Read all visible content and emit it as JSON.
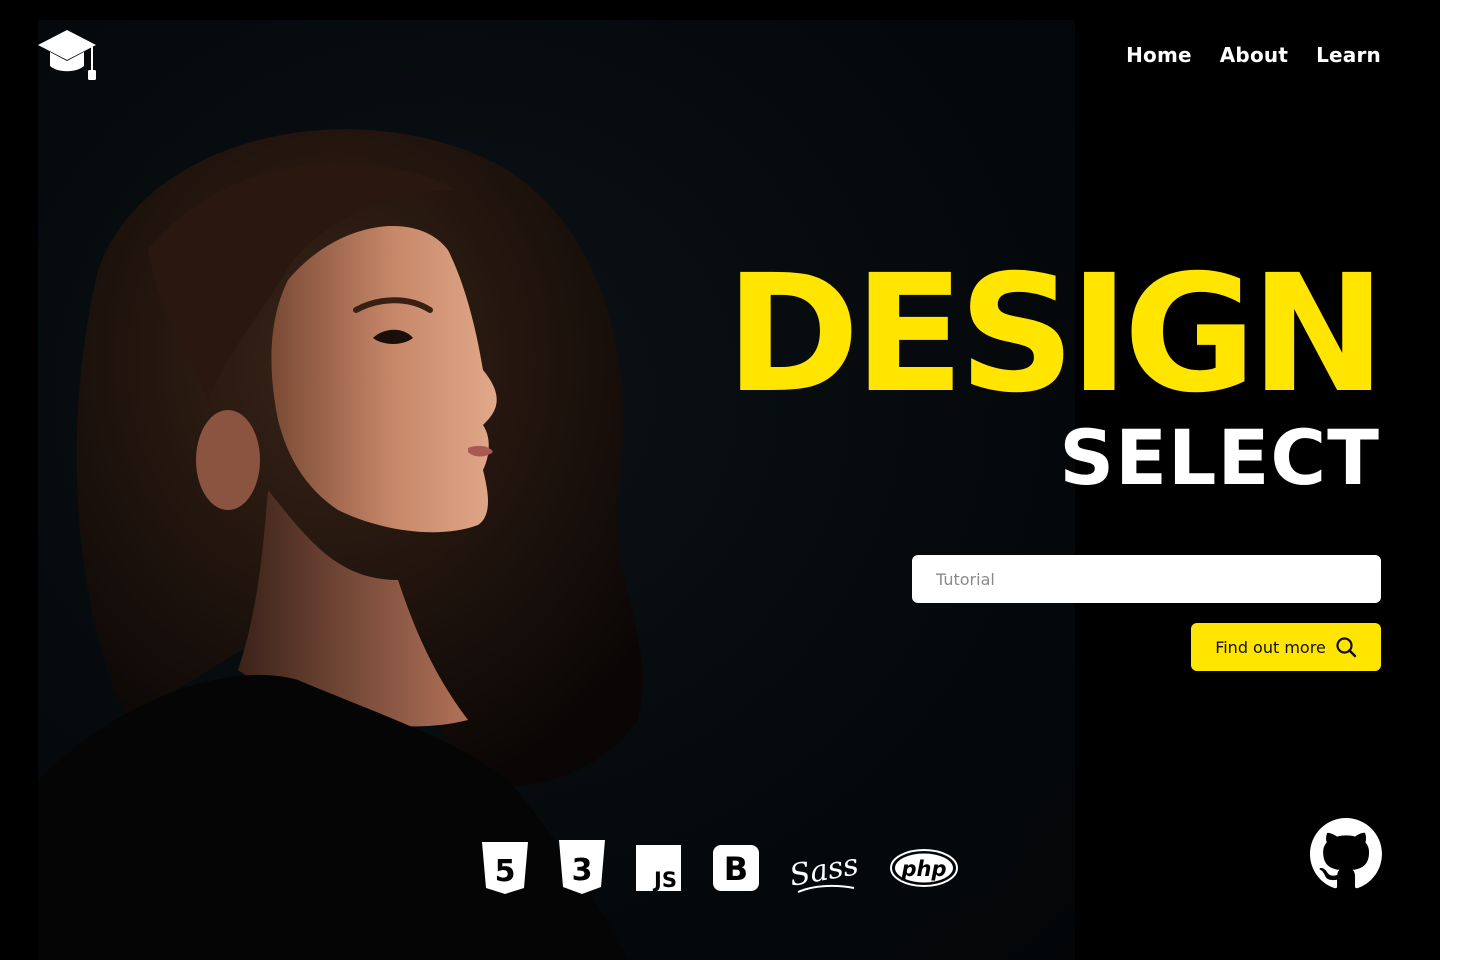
{
  "nav": {
    "home": "Home",
    "about": "About",
    "learn": "Learn"
  },
  "hero": {
    "title": "DESIGN",
    "subtitle": "SELECT"
  },
  "search": {
    "placeholder": "Tutorial",
    "value": ""
  },
  "cta": {
    "label": "Find out more",
    "icon": "search-icon"
  },
  "tech_icons": [
    {
      "name": "html5-icon",
      "text": "5"
    },
    {
      "name": "css3-icon",
      "text": "3"
    },
    {
      "name": "javascript-icon",
      "text": "JS"
    },
    {
      "name": "bootstrap-icon",
      "text": "B"
    },
    {
      "name": "sass-icon",
      "text": "Sass"
    },
    {
      "name": "php-icon",
      "text": "php"
    }
  ],
  "social": {
    "icon": "github-icon"
  },
  "logo": {
    "icon": "graduation-cap-icon"
  },
  "colors": {
    "accent": "#FFE500",
    "background": "#000000",
    "text": "#FFFFFF"
  }
}
